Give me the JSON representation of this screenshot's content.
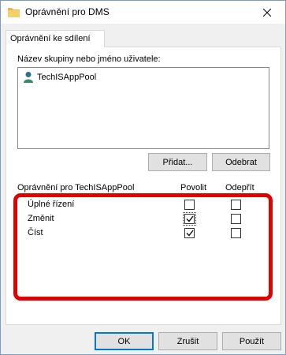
{
  "window": {
    "title": "Oprávnění pro DMS",
    "folder_icon_color": "#e8b745",
    "close_symbol": "✕"
  },
  "tab": {
    "label": "Oprávnění ke sdílení"
  },
  "group_list": {
    "label": "Název skupiny nebo jméno uživatele:",
    "items": [
      {
        "name": "TechISAppPool",
        "icon": "user-icon"
      }
    ]
  },
  "buttons": {
    "add": "Přidat...",
    "remove": "Odebrat",
    "ok": "OK",
    "cancel": "Zrušit",
    "apply": "Použít"
  },
  "permissions": {
    "header": "Oprávnění pro TechISAppPool",
    "allow_header": "Povolit",
    "deny_header": "Odepřít",
    "rows": [
      {
        "name": "Úplné řízení",
        "allow": false,
        "deny": false
      },
      {
        "name": "Změnit",
        "allow": true,
        "deny": false
      },
      {
        "name": "Číst",
        "allow": true,
        "deny": false
      }
    ]
  },
  "highlight_color": "#e00000"
}
